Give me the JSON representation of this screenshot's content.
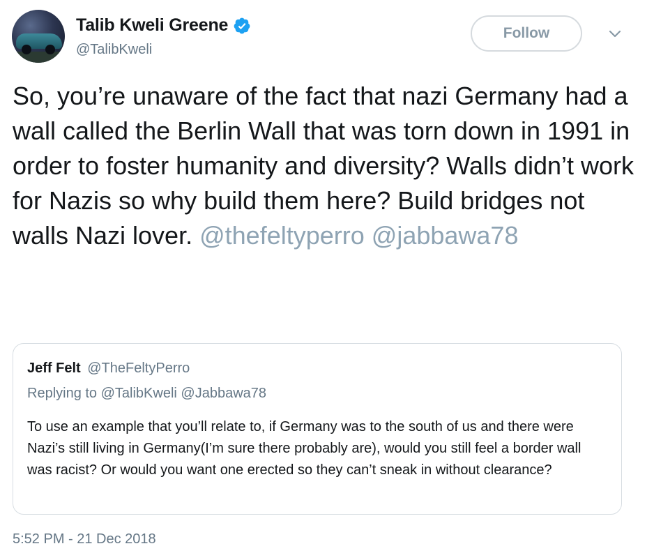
{
  "author": {
    "display_name": "Talib Kweli Greene",
    "handle": "@TalibKweli",
    "verified": true
  },
  "follow_button": {
    "label": "Follow"
  },
  "tweet": {
    "text": "So, you’re unaware of the fact that nazi Germany had a wall called the Berlin Wall that was torn down in 1991 in order to foster humanity and diversity? Walls didn’t work for Nazis so why build them here? Build bridges not walls Nazi lover.",
    "mentions": [
      "@thefeltyperro",
      "@jabbawa78"
    ],
    "timestamp": "5:52 PM - 21 Dec 2018"
  },
  "quoted_tweet": {
    "display_name": "Jeff Felt",
    "handle": "@TheFeltyPerro",
    "replying_to": "Replying to @TalibKweli @Jabbawa78",
    "text": "To use an example that you’ll relate to, if Germany was to the south of us and there were Nazi’s still living in Germany(I’m sure there probably are), would you still feel a border wall was racist? Or would you want one erected so they can’t sneak in without clearance?"
  },
  "colors": {
    "text": "#14171a",
    "secondary": "#657786",
    "mention": "#8ea3b3",
    "verified_badge": "#1da1f2",
    "border": "#d7dde2"
  },
  "icons": [
    "verified-badge-icon",
    "chevron-down-icon",
    "avatar"
  ]
}
